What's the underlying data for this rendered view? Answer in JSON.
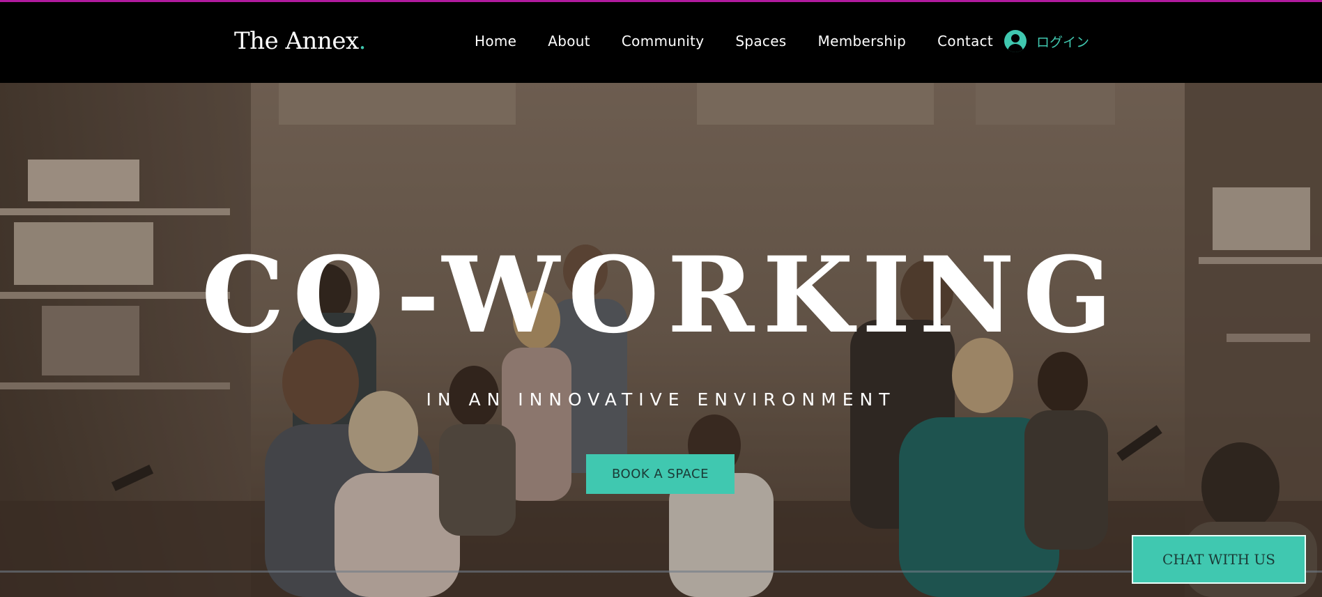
{
  "header": {
    "logo_text": "The Annex",
    "logo_dot": ".",
    "nav": [
      {
        "label": "Home"
      },
      {
        "label": "About"
      },
      {
        "label": "Community"
      },
      {
        "label": "Spaces"
      },
      {
        "label": "Membership"
      },
      {
        "label": "Contact"
      }
    ],
    "login_label": "ログイン",
    "login_icon": "user-avatar-icon"
  },
  "hero": {
    "headline": "CO-WORKING",
    "subheadline": "IN AN INNOVATIVE ENVIRONMENT",
    "cta_label": "BOOK A SPACE",
    "background": "office-coworking-photo"
  },
  "chat_button": {
    "label": "CHAT WITH US"
  },
  "colors": {
    "accent": "#40c8b0",
    "header_bg": "#000000",
    "top_line": "#b01a9e"
  }
}
